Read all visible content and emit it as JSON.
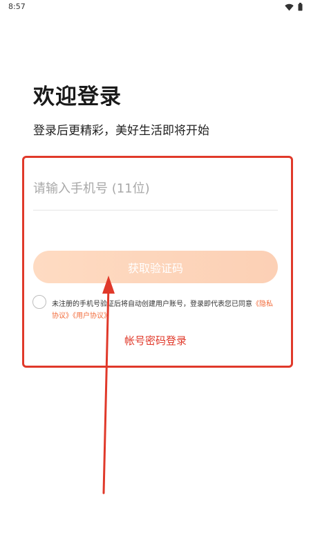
{
  "status_bar": {
    "time": "8:57",
    "icons": [
      "wifi-icon",
      "battery-icon"
    ]
  },
  "header": {
    "title": "欢迎登录",
    "subtitle": "登录后更精彩，美好生活即将开始"
  },
  "form": {
    "phone_placeholder": "请输入手机号 (11位)",
    "phone_value": "",
    "get_code_label": "获取验证码",
    "agreement": {
      "text_before": "未注册的手机号验证后将自动创建用户账号，登录即代表您已同意",
      "privacy_link": "《隐私协议》",
      "user_link": "《用户协议》",
      "checked": false
    },
    "password_login_label": "帐号密码登录"
  },
  "colors": {
    "accent_red": "#e0392a",
    "link_orange": "#f26b3a",
    "button_gradient_start": "#fedbc2",
    "button_gradient_end": "#fcd0b5"
  }
}
